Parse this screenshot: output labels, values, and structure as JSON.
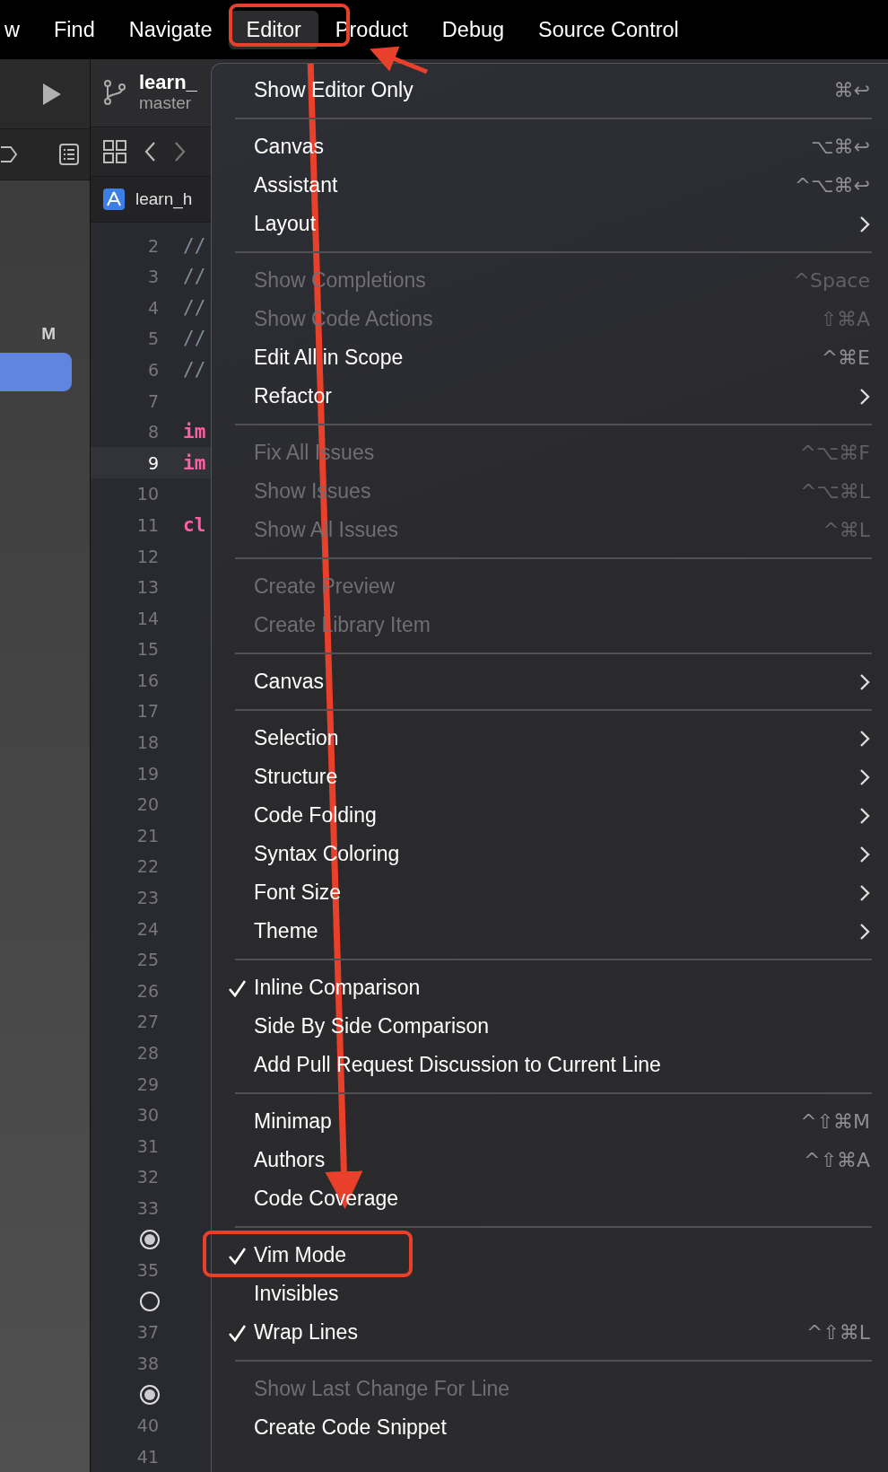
{
  "menubar": [
    {
      "label": "w",
      "selected": false
    },
    {
      "label": "Find",
      "selected": false
    },
    {
      "label": "Navigate",
      "selected": false
    },
    {
      "label": "Editor",
      "selected": true
    },
    {
      "label": "Product",
      "selected": false
    },
    {
      "label": "Debug",
      "selected": false
    },
    {
      "label": "Source Control",
      "selected": false
    }
  ],
  "sidebar": {
    "badge": "M",
    "selected_row": true
  },
  "editor": {
    "project": "learn_",
    "branch": "master",
    "tab": "learn_h",
    "lines": [
      {
        "number": "2",
        "token": {
          "text": "//",
          "kind": "comment"
        }
      },
      {
        "number": "3",
        "token": {
          "text": "//",
          "kind": "comment"
        }
      },
      {
        "number": "4",
        "token": {
          "text": "//",
          "kind": "comment"
        }
      },
      {
        "number": "5",
        "token": {
          "text": "//",
          "kind": "comment"
        }
      },
      {
        "number": "6",
        "token": {
          "text": "//",
          "kind": "comment"
        }
      },
      {
        "number": "7"
      },
      {
        "number": "8",
        "token": {
          "text": "im",
          "kind": "keyword"
        }
      },
      {
        "number": "9",
        "current": true,
        "token": {
          "text": "im",
          "kind": "keyword"
        }
      },
      {
        "number": "10"
      },
      {
        "number": "11",
        "token": {
          "text": "cl",
          "kind": "keyword"
        }
      },
      {
        "number": "12"
      },
      {
        "number": "13"
      },
      {
        "number": "14"
      },
      {
        "number": "15"
      },
      {
        "number": "16"
      },
      {
        "number": "17"
      },
      {
        "number": "18"
      },
      {
        "number": "19"
      },
      {
        "number": "20"
      },
      {
        "number": "21"
      },
      {
        "number": "22"
      },
      {
        "number": "23"
      },
      {
        "number": "24"
      },
      {
        "number": "25"
      },
      {
        "number": "26"
      },
      {
        "number": "27"
      },
      {
        "number": "28"
      },
      {
        "number": "29"
      },
      {
        "number": "30"
      },
      {
        "number": "31"
      },
      {
        "number": "32"
      },
      {
        "number": "33"
      },
      {
        "kind": "marker",
        "filled": true
      },
      {
        "number": "35"
      },
      {
        "kind": "marker",
        "filled": false
      },
      {
        "number": "37"
      },
      {
        "number": "38"
      },
      {
        "kind": "marker",
        "filled": true
      },
      {
        "number": "40"
      },
      {
        "number": "41"
      }
    ]
  },
  "menu": {
    "items": [
      {
        "kind": "command",
        "label": "Show Editor Only",
        "shortcut": "⌘↩",
        "disabled": false,
        "checked": false
      },
      {
        "kind": "separator"
      },
      {
        "kind": "command",
        "label": "Canvas",
        "shortcut": "⌥⌘↩",
        "disabled": false,
        "checked": false
      },
      {
        "kind": "command",
        "label": "Assistant",
        "shortcut": "^⌥⌘↩",
        "disabled": false,
        "checked": false
      },
      {
        "kind": "submenu",
        "label": "Layout",
        "disabled": false,
        "checked": false
      },
      {
        "kind": "separator"
      },
      {
        "kind": "command",
        "label": "Show Completions",
        "shortcut": "^Space",
        "disabled": true,
        "checked": false
      },
      {
        "kind": "command",
        "label": "Show Code Actions",
        "shortcut": "⇧⌘A",
        "disabled": true,
        "checked": false
      },
      {
        "kind": "command",
        "label": "Edit All in Scope",
        "shortcut": "^⌘E",
        "disabled": false,
        "checked": false
      },
      {
        "kind": "submenu",
        "label": "Refactor",
        "disabled": false,
        "checked": false
      },
      {
        "kind": "separator"
      },
      {
        "kind": "command",
        "label": "Fix All Issues",
        "shortcut": "^⌥⌘F",
        "disabled": true,
        "checked": false
      },
      {
        "kind": "command",
        "label": "Show Issues",
        "shortcut": "^⌥⌘L",
        "disabled": true,
        "checked": false
      },
      {
        "kind": "command",
        "label": "Show All Issues",
        "shortcut": "^⌘L",
        "disabled": true,
        "checked": false
      },
      {
        "kind": "separator"
      },
      {
        "kind": "command",
        "label": "Create Preview",
        "disabled": true,
        "checked": false
      },
      {
        "kind": "command",
        "label": "Create Library Item",
        "disabled": true,
        "checked": false
      },
      {
        "kind": "separator"
      },
      {
        "kind": "submenu",
        "label": "Canvas",
        "disabled": false,
        "checked": false
      },
      {
        "kind": "separator"
      },
      {
        "kind": "submenu",
        "label": "Selection",
        "disabled": false,
        "checked": false
      },
      {
        "kind": "submenu",
        "label": "Structure",
        "disabled": false,
        "checked": false
      },
      {
        "kind": "submenu",
        "label": "Code Folding",
        "disabled": false,
        "checked": false
      },
      {
        "kind": "submenu",
        "label": "Syntax Coloring",
        "disabled": false,
        "checked": false
      },
      {
        "kind": "submenu",
        "label": "Font Size",
        "disabled": false,
        "checked": false
      },
      {
        "kind": "submenu",
        "label": "Theme",
        "disabled": false,
        "checked": false
      },
      {
        "kind": "separator"
      },
      {
        "kind": "command",
        "label": "Inline Comparison",
        "disabled": false,
        "checked": true
      },
      {
        "kind": "command",
        "label": "Side By Side Comparison",
        "disabled": false,
        "checked": false
      },
      {
        "kind": "command",
        "label": "Add Pull Request Discussion to Current Line",
        "disabled": false,
        "checked": false
      },
      {
        "kind": "separator"
      },
      {
        "kind": "command",
        "label": "Minimap",
        "shortcut": "^⇧⌘M",
        "disabled": false,
        "checked": false
      },
      {
        "kind": "command",
        "label": "Authors",
        "shortcut": "^⇧⌘A",
        "disabled": false,
        "checked": false
      },
      {
        "kind": "command",
        "label": "Code Coverage",
        "disabled": false,
        "checked": false
      },
      {
        "kind": "separator"
      },
      {
        "kind": "command",
        "label": "Vim Mode",
        "disabled": false,
        "checked": true
      },
      {
        "kind": "command",
        "label": "Invisibles",
        "disabled": false,
        "checked": false
      },
      {
        "kind": "command",
        "label": "Wrap Lines",
        "shortcut": "^⇧⌘L",
        "disabled": false,
        "checked": true
      },
      {
        "kind": "separator"
      },
      {
        "kind": "command",
        "label": "Show Last Change For Line",
        "disabled": true,
        "checked": false
      },
      {
        "kind": "command",
        "label": "Create Code Snippet",
        "disabled": false,
        "checked": false
      }
    ]
  }
}
